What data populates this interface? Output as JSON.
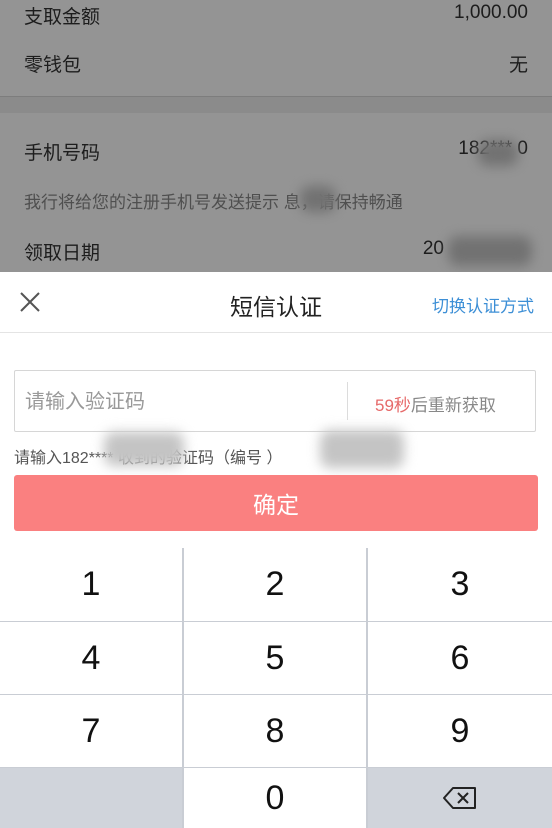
{
  "background_page": {
    "rows": [
      {
        "label": "支取金额",
        "value": "1,000.00"
      },
      {
        "label": "零钱包",
        "value": "无"
      },
      {
        "label": "手机号码",
        "value": "182***  0"
      },
      {
        "label": "领取日期",
        "value": "20"
      }
    ],
    "hint": "我行将给您的注册手机号发送提示  息，请保持畅通"
  },
  "sheet": {
    "title": "短信认证",
    "switch_label": "切换认证方式",
    "code_placeholder": "请输入验证码",
    "countdown": "59秒",
    "resend_suffix": "后重新获取",
    "sms_hint": "请输入182****      收到的验证码（编号         ）",
    "confirm_label": "确定"
  },
  "keypad": {
    "keys": [
      "1",
      "2",
      "3",
      "4",
      "5",
      "6",
      "7",
      "8",
      "9",
      "0"
    ]
  },
  "colors": {
    "confirm_button": "#fa8080",
    "link": "#3d8fd6",
    "countdown": "#e66a6a"
  },
  "icons": {
    "close": "close-icon",
    "backspace": "backspace-icon"
  }
}
